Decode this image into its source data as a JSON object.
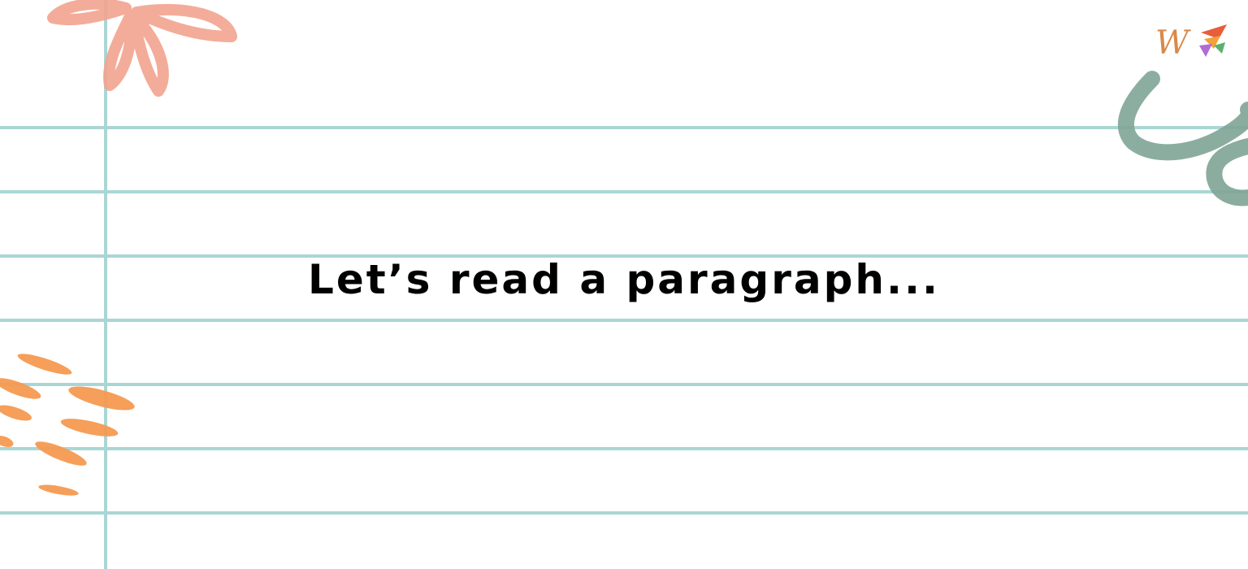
{
  "slide": {
    "heading": "Let’s read a paragraph..."
  },
  "colors": {
    "background": "#ffffff",
    "rule_lines": "#a9d6d5",
    "flower": "#f2a48f",
    "squiggle": "#7fa596",
    "brush_strokes": "#f59a52",
    "logo_w": "#d9894a",
    "logo_flags": [
      "#e85d3a",
      "#f0a23b",
      "#b36bd6",
      "#5ab26e"
    ]
  },
  "icons": {
    "flower": "flower-doodle-icon",
    "squiggle": "squiggle-doodle-icon",
    "brush": "brush-strokes-doodle-icon",
    "logo": "brand-logo-icon"
  }
}
